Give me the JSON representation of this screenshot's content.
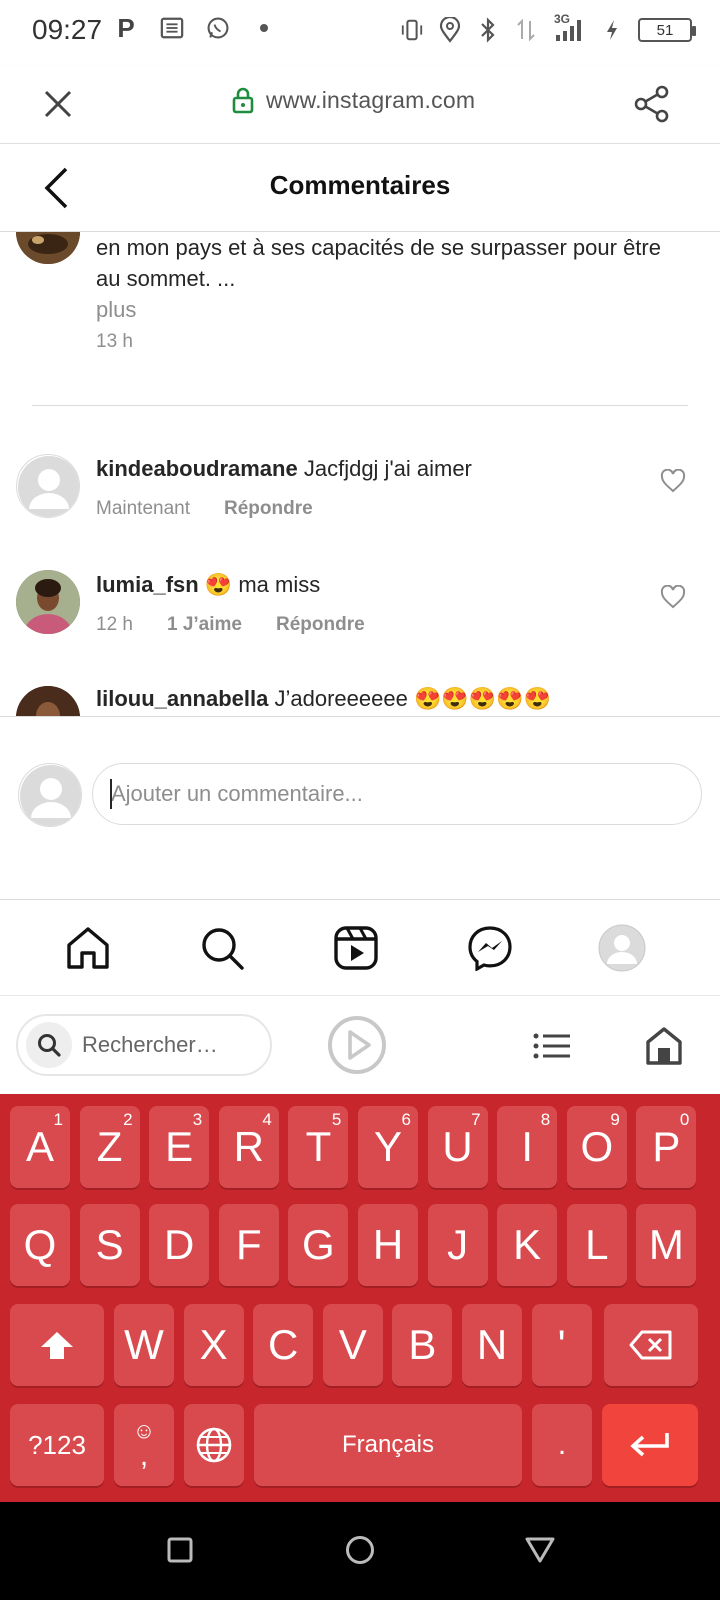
{
  "status_bar": {
    "time": "09:27",
    "network": "3G",
    "battery": "51"
  },
  "browser": {
    "url": "www.instagram.com"
  },
  "header": {
    "title": "Commentaires"
  },
  "caption": {
    "text_line1": "en mon pays et à ses capacités de se surpasser pour être",
    "text_line2": "au sommet. ...",
    "more": "plus",
    "time": "13 h"
  },
  "comments": [
    {
      "username": "kindeaboudramane",
      "text": "Jacfjdgj j'ai aimer",
      "time": "Maintenant",
      "likes": "",
      "reply": "Répondre"
    },
    {
      "username": "lumia_fsn",
      "text": "😍 ma miss",
      "time": "12 h",
      "likes": "1 J’aime",
      "reply": "Répondre"
    },
    {
      "username": "lilouu_annabella",
      "text": "J’adoreeeeee 😍😍😍😍😍"
    }
  ],
  "add_comment": {
    "placeholder": "Ajouter un commentaire..."
  },
  "keyboard": {
    "search_placeholder": "Rechercher…",
    "row1": [
      {
        "k": "A",
        "h": "1"
      },
      {
        "k": "Z",
        "h": "2"
      },
      {
        "k": "E",
        "h": "3"
      },
      {
        "k": "R",
        "h": "4"
      },
      {
        "k": "T",
        "h": "5"
      },
      {
        "k": "Y",
        "h": "6"
      },
      {
        "k": "U",
        "h": "7"
      },
      {
        "k": "I",
        "h": "8"
      },
      {
        "k": "O",
        "h": "9"
      },
      {
        "k": "P",
        "h": "0"
      }
    ],
    "row2": [
      "Q",
      "S",
      "D",
      "F",
      "G",
      "H",
      "J",
      "K",
      "L",
      "M"
    ],
    "row3": [
      "W",
      "X",
      "C",
      "V",
      "B",
      "N",
      "'"
    ],
    "symbols_label": "?123",
    "emoji_label": "☺",
    "comma_label": ",",
    "space_label": "Français",
    "period_label": ".",
    "colors": {
      "background": "#c7262c",
      "key": "#d94a4e",
      "enter": "#f0443d"
    }
  }
}
